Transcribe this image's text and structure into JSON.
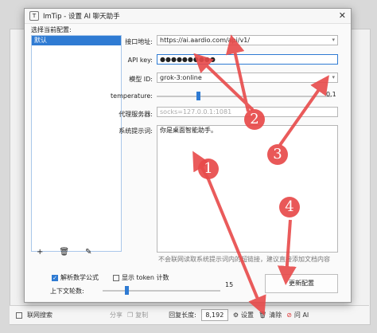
{
  "bottom_bar": {
    "search_label": "联网搜索",
    "share_label": "分享",
    "copy_label": "复制",
    "reply_length_label": "回复长度:",
    "reply_length_value": "8,192",
    "settings_label": "设置",
    "clear_label": "清除",
    "ask_label": "问 AI"
  },
  "dialog": {
    "title": "ImTip - 设置 AI 聊天助手",
    "close_icon": "close-icon",
    "select_config_label": "选择当前配置:",
    "configs": [
      "默认"
    ],
    "list_tools": {
      "add_icon": "plus-icon",
      "delete_icon": "trash-icon",
      "edit_icon": "edit-icon"
    },
    "api_url": {
      "label": "接口地址:",
      "value": "https://ai.aardio.com/api/v1/"
    },
    "api_key": {
      "label": "API key:",
      "value": "●●●●●●●●●●"
    },
    "model_id": {
      "label": "模型 ID:",
      "value": "grok-3:online"
    },
    "temperature": {
      "label": "temperature:",
      "value": "0.1",
      "level": 0.1
    },
    "proxy": {
      "label": "代理服务器:",
      "placeholder": "socks=127.0.0.1:1081"
    },
    "system_prompt": {
      "label": "系统提示词:",
      "value": "你是桌面智能助手。"
    },
    "hint": "不会联网读取系统提示词内的超链接，建议直接添加文档内容",
    "parse_math": {
      "label": "解析数学公式",
      "checked": true
    },
    "show_tokens": {
      "label": "显示 token 计数",
      "checked": false
    },
    "context_rounds": {
      "label": "上下文轮数:",
      "value": "15",
      "level": 0.0
    },
    "update_button": "更新配置"
  },
  "annotations": [
    "1",
    "2",
    "3",
    "4"
  ],
  "colors": {
    "accent": "#2f7bd3",
    "marker": "#e84a4a"
  }
}
